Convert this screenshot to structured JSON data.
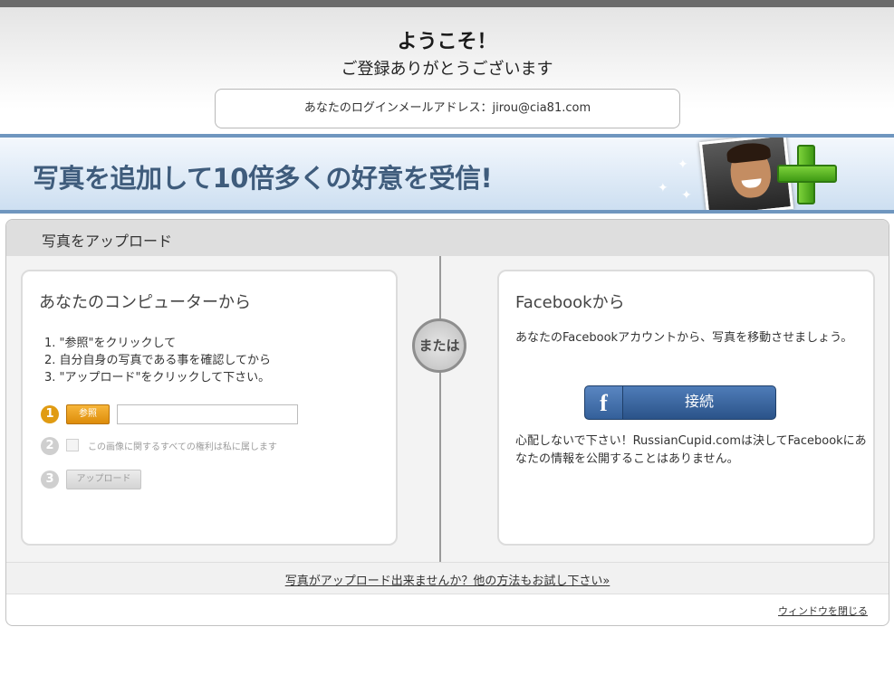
{
  "welcome": {
    "title": "ようこそ！",
    "subtitle": "ご登録ありがとうございます",
    "email_line": "あなたのログインメールアドレス：jirou@cia81.com"
  },
  "banner": {
    "text": "写真を追加して10倍多くの好意を受信!"
  },
  "upload_panel": {
    "title": "写真をアップロード",
    "or_label": "または",
    "computer": {
      "title": "あなたのコンピューターから",
      "steps": [
        "1. \"参照\"をクリックして",
        "2. 自分自身の写真である事を確認してから",
        "3. \"アップロード\"をクリックして下さい。"
      ],
      "step_numbers": [
        "1",
        "2",
        "3"
      ],
      "browse_label": "参照",
      "file_value": "",
      "rights_label": "この画像に関するすべての権利は私に属します",
      "upload_label": "アップロード"
    },
    "facebook": {
      "title": "Facebookから",
      "description": "あなたのFacebookアカウントから、写真を移動させましょう。",
      "logo": "f",
      "connect_label": "接続",
      "note": "心配しないで下さい！RussianCupid.comは決してFacebookにあなたの情報を公開することはありません。"
    },
    "alt_link": "写真がアップロード出来ませんか？他の方法もお試し下さい»",
    "close_link": "ウィンドウを閉じる"
  },
  "colors": {
    "accent_orange": "#e09b12",
    "facebook_blue": "#3b5f94",
    "banner_text": "#3f5c7c"
  }
}
